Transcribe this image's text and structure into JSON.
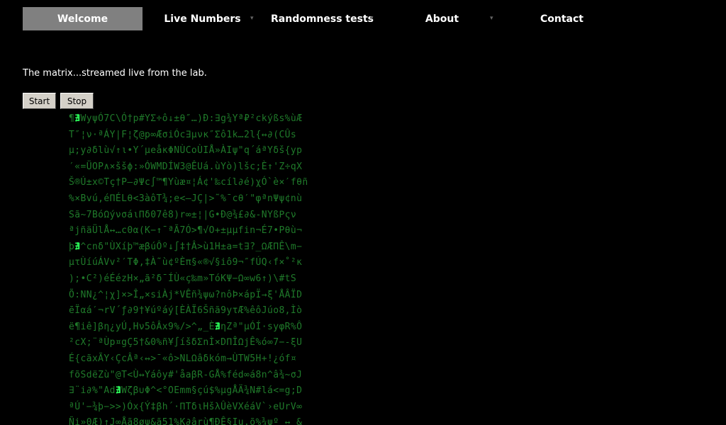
{
  "nav": {
    "items": [
      {
        "label": "Welcome",
        "active": true,
        "has_dropdown": false
      },
      {
        "label": "Live Numbers",
        "active": false,
        "has_dropdown": true
      },
      {
        "label": "Randomness tests",
        "active": false,
        "has_dropdown": true
      },
      {
        "label": "About",
        "active": false,
        "has_dropdown": true
      },
      {
        "label": "Contact",
        "active": false,
        "has_dropdown": false
      }
    ]
  },
  "intro_text": "The matrix...streamed live from the lab.",
  "controls": {
    "start_label": "Start",
    "stop_label": "Stop"
  },
  "colors": {
    "background": "#000000",
    "active_tab": "#808080",
    "matrix_text": "#1f7a2a",
    "matrix_highlight": "#2cff5a"
  },
  "matrix_lines": [
    "¶∄WyψÓ7C\\Ó†p#YΣ÷ô↓±θ″…)Đ:∃g¾Yª₽²ckýßs%ùÆ",
    "T″¦ν·ªÁY|F¦ζ@p∞ÆσiÓc∃μνκ″Σô1k…2l{↔∂(CÛs",
    "μ;y∂δlù√↑ι•Y´μeåκΦNÙCoÙIÅ»ÀIψ\"q´áªYδš{yp",
    "′«=ÜOP∧×ššϕ:»ÓWMDÍW3@ÊUá.ùYò)lšc;È↑'Z÷qX",
    "Š®Ú±x©Tç†P—∂Ψc∫™¶Yùæ¤¦Á¢'‰cíl∂é)χÓ`è×′fθñ",
    "%×Bvú,éΠÉLθ<3àôT¾;e<—JÇ|>˜%¯cθ′\"φªnΨψ¢nù",
    "Sã~7BóΩýνσáιΠδ07ê8)r∞±¦|G•Đ@¾£∂&-NYßΡςν",
    "ªjñäÜlÅ↔…c0α(K−↑¯ªÃ7Ó>¶√O+±μμfin¬É7•Pθù¬",
    "þ∄^cnδ\"ÙXíþ™æβúÔº↓∫‡†Â>ù1H±a=t∃?_ΩÆΠÊ\\m−",
    "μτÙíúÁVv²′TΦ,‡À˜ù¢ºÈπ§«®√§iô9¬″fÚQ‹f×˚²κ",
    ");•C²)éÉézH×„ã²δ¯ÍÙ«ç‰m»TóKΨ−Ω∞w6↑)\\#tS",
    "Õ:NN¿^¦χ]×>Î„×siÀj*VÊñ¾ψω?nôÞ×ápΪ→ξ'ÅÂÏD",
    "ēÏαá′¬rV´ƒ∂9†¥úºáý[ÈÀÏ6Šñã9yτÆ%êôJúo8,Ìò",
    "ë¶iê]βη¿yÚ,Hν5ôÂx9%/>^„_È∄ηZª\"μÓÍ·syφR%Ô",
    "²cX;¨ªÙp¤gÇ5†&0%ñ¥∫íšδΣnÌ×DΠÎΩjÊ%ó∞7−-ξU",
    "É{cãxÃY‹ÇcÂª‹↔>¯«ô>NLΩâδkóm→ÙTW5H+!¿óf¤",
    "fõSdëZù\"@T<Ù↔Yáôy#'åaβR-GÅ%féd∞á8n^â¾~σJ",
    "∃¨i∂%\"Ad∄Wζβ∪Φ^<°OEmm§çú$%μgÅÄ¾N#lá<=g;D",
    "ªÚ'−¾þ−>>)Óx{Ý‡βh´·ΠTδιHšλÛèVXéáV`›eUrV∞",
    "Ñi»0Æ)↑J∞Åã8øψ&ã51%K∂ârù¶ÐÊ§Iu.õ%¾ψº ↔ &"
  ]
}
